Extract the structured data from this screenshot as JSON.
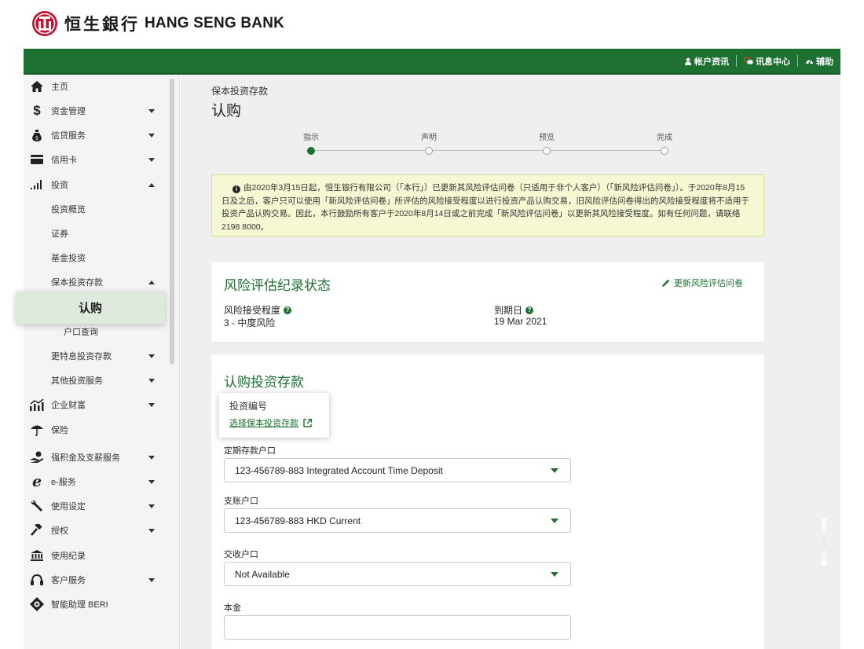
{
  "brand": {
    "name_cn": "恒生銀行",
    "name_en": "HANG SENG BANK"
  },
  "topbar": {
    "links": [
      {
        "label": "帐户资讯",
        "icon": "person-icon"
      },
      {
        "label": "讯息中心",
        "icon": "chat-icon"
      },
      {
        "label": "辅助",
        "icon": "gauge-icon"
      }
    ]
  },
  "sidebar": {
    "items": [
      {
        "label": "主页",
        "icon": "home-icon"
      },
      {
        "label": "资金管理",
        "icon": "dollar-icon",
        "caret": "down"
      },
      {
        "label": "信贷服务",
        "icon": "money-bag-icon",
        "caret": "down"
      },
      {
        "label": "信用卡",
        "icon": "credit-card-icon",
        "caret": "down"
      },
      {
        "label": "投资",
        "icon": "bar-chart-icon",
        "caret": "up"
      },
      {
        "label": "投资概览"
      },
      {
        "label": "证券"
      },
      {
        "label": "基金投资"
      },
      {
        "label": "保本投资存款",
        "caret": "up"
      },
      {
        "label": "认购",
        "active": true
      },
      {
        "label": "户口查询"
      },
      {
        "label": "更特息投资存款",
        "caret": "down"
      },
      {
        "label": "其他投资服务",
        "caret": "down"
      },
      {
        "label": "企业财富",
        "icon": "growth-chart-icon",
        "caret": "down"
      },
      {
        "label": "保险",
        "icon": "umbrella-icon"
      },
      {
        "label": "强积金及支薪服务",
        "icon": "hand-coin-icon",
        "caret": "down"
      },
      {
        "label": "e-服务",
        "icon": "e-service-icon",
        "caret": "down"
      },
      {
        "label": "使用设定",
        "icon": "wrench-icon",
        "caret": "down"
      },
      {
        "label": "授权",
        "icon": "gavel-icon",
        "caret": "down"
      },
      {
        "label": "使用纪录",
        "icon": "bank-building-icon"
      },
      {
        "label": "客户服务",
        "icon": "headset-icon",
        "caret": "down"
      },
      {
        "label": "智能助理 BERI",
        "icon": "beri-icon"
      }
    ]
  },
  "main": {
    "breadcrumb": "保本投资存款",
    "title": "认购",
    "steps": [
      {
        "label": "指示",
        "active": true
      },
      {
        "label": "声明",
        "active": false
      },
      {
        "label": "预览",
        "active": false
      },
      {
        "label": "完成",
        "active": false
      }
    ],
    "notice": "由2020年3月15日起，恒生银行有限公司（「本行」）已更新其风险评估问卷（只适用于非个人客户）（「新风险评估问卷」）。于2020年8月15日及之后，客户只可以使用「新风险评估问卷」所评估的风险接受程度以进行投资产品认购交易，旧风险评估问卷得出的风险接受程度将不适用于投资产品认购交易。因此，本行鼓励所有客户于2020年8月14日或之前完成「新风险评估问卷」以更新其风险接受程度。如有任何问题，请联络2198 8000。",
    "risk_card": {
      "title": "风险评估纪录状态",
      "update_link": "更新风险评估问卷",
      "tolerance_label": "风险接受程度",
      "tolerance_value": "3 - 中度风险",
      "expiry_label": "到期日",
      "expiry_value": "19 Mar 2021"
    },
    "form": {
      "title": "认购投资存款",
      "investment_no_label": "投资编号",
      "investment_no_link": "选择保本投资存款",
      "time_deposit_label": "定期存款户口",
      "time_deposit_value": "123-456789-883  Integrated Account Time Deposit",
      "debit_label": "支账户口",
      "debit_value": "123-456789-883  HKD Current",
      "settlement_label": "交收户口",
      "settlement_value": "Not Available",
      "principal_label": "本金",
      "principal_value": ""
    }
  },
  "colors": {
    "brand_green": "#1e6f32",
    "notice_bg": "#f5f8d3",
    "active_nav_bg": "#dfe9de",
    "logo_red": "#c8102e"
  }
}
